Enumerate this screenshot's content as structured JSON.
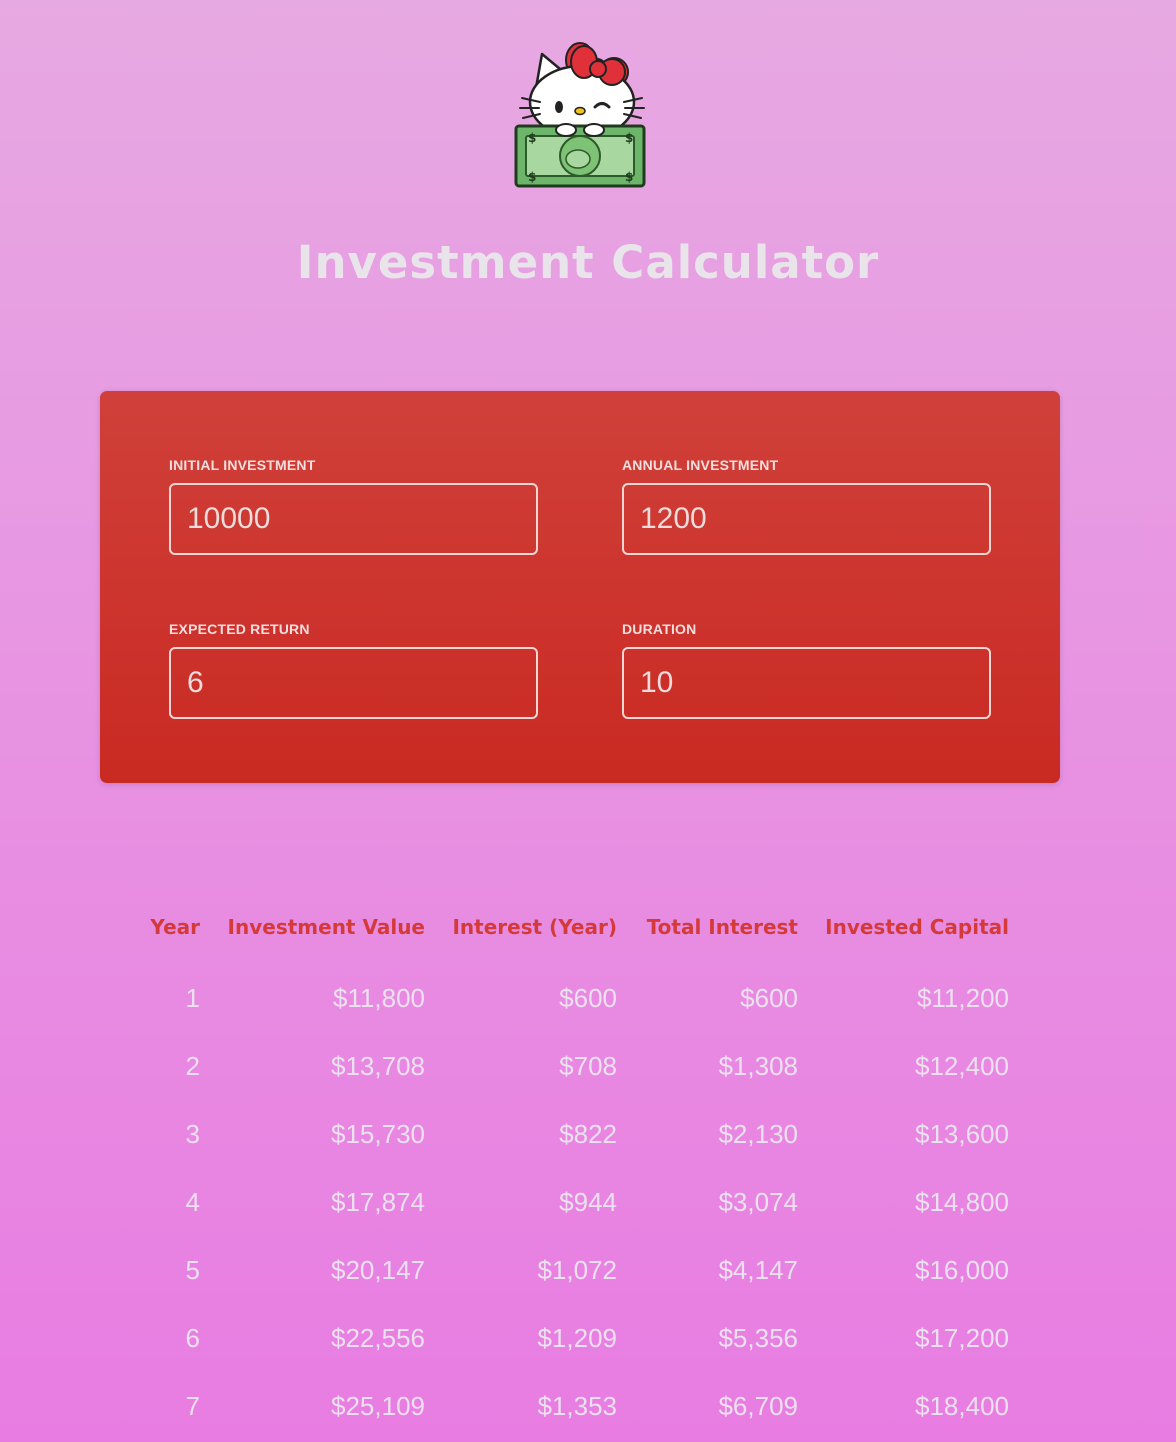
{
  "header": {
    "logo_alt": "Hello Kitty logo",
    "title": "Investment Calculator"
  },
  "inputs": {
    "initial_investment": {
      "label": "INITIAL INVESTMENT",
      "value": "10000"
    },
    "annual_investment": {
      "label": "ANNUAL INVESTMENT",
      "value": "1200"
    },
    "expected_return": {
      "label": "EXPECTED RETURN",
      "value": "6"
    },
    "duration": {
      "label": "DURATION",
      "value": "10"
    }
  },
  "table": {
    "headers": [
      "Year",
      "Investment Value",
      "Interest (Year)",
      "Total Interest",
      "Invested Capital"
    ],
    "rows": [
      [
        "1",
        "$11,800",
        "$600",
        "$600",
        "$11,200"
      ],
      [
        "2",
        "$13,708",
        "$708",
        "$1,308",
        "$12,400"
      ],
      [
        "3",
        "$15,730",
        "$822",
        "$2,130",
        "$13,600"
      ],
      [
        "4",
        "$17,874",
        "$944",
        "$3,074",
        "$14,800"
      ],
      [
        "5",
        "$20,147",
        "$1,072",
        "$4,147",
        "$16,000"
      ],
      [
        "6",
        "$22,556",
        "$1,209",
        "$5,356",
        "$17,200"
      ],
      [
        "7",
        "$25,109",
        "$1,353",
        "$6,709",
        "$18,400"
      ]
    ]
  },
  "colors": {
    "background_top": "#e7a9e2",
    "background_bottom": "#e87ce2",
    "panel_top": "#d0403a",
    "panel_bottom": "#c92a22",
    "table_header": "#d53a3a",
    "table_text": "#ebe1ee",
    "title": "#e9e3ea"
  }
}
